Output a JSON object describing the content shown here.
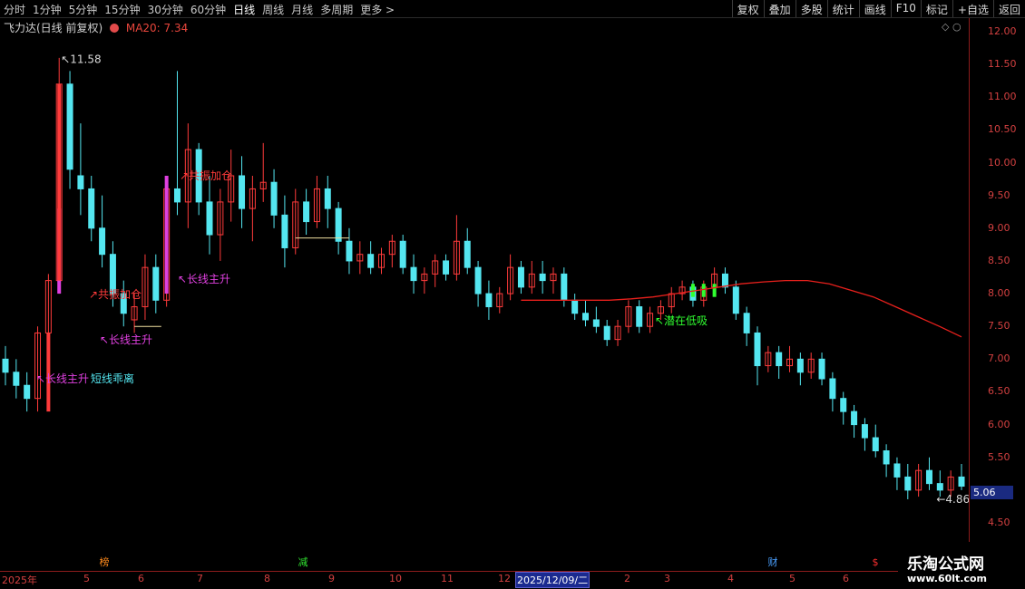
{
  "toolbar": {
    "periods": [
      "分时",
      "1分钟",
      "5分钟",
      "15分钟",
      "30分钟",
      "60分钟",
      "日线",
      "周线",
      "月线",
      "多周期",
      "更多 >"
    ],
    "active_period": "日线",
    "tools": [
      "复权",
      "叠加",
      "多股",
      "统计",
      "画线",
      "F10",
      "标记",
      "+自选",
      "返回"
    ]
  },
  "stock": {
    "name": "飞力达(日线 前复权)",
    "ma_label": "MA20: 7.34"
  },
  "colors": {
    "up": "#ff3b3b",
    "down": "#54e6f0",
    "ma20": "#e8201c",
    "axis": "#8c1c1c",
    "signal_magenta": "#e040e0",
    "signal_green": "#30ff30"
  },
  "yaxis": {
    "ticks": [
      "12.00",
      "11.50",
      "11.00",
      "10.50",
      "10.00",
      "9.50",
      "9.00",
      "8.50",
      "8.00",
      "7.50",
      "7.00",
      "6.50",
      "6.00",
      "5.50",
      "5.00",
      "4.50"
    ],
    "current_price": "5.06"
  },
  "annotations": {
    "high": "11.58",
    "low": "4.86",
    "a1": "长线主升",
    "a2": "短线乖离",
    "a3": "长线主升",
    "a4": "共振加仓",
    "a5": "长线主升",
    "a6": "共振加仓",
    "a7": "潜在低吸"
  },
  "events": [
    {
      "label": "榜",
      "color": "#ff8a1c"
    },
    {
      "label": "减",
      "color": "#30e030"
    },
    {
      "label": "财",
      "color": "#4aa0ff"
    },
    {
      "label": "$",
      "color": "#ff3030"
    }
  ],
  "xaxis": {
    "labels": [
      "2025年",
      "5",
      "6",
      "7",
      "8",
      "9",
      "10",
      "11",
      "12",
      "2025/12/09/二",
      "2",
      "3",
      "4",
      "5",
      "6"
    ]
  },
  "brand": {
    "name": "乐淘公式网",
    "url": "www.60lt.com"
  },
  "chart_data": {
    "type": "candlestick",
    "title": "飞力达(日线 前复权)",
    "ylim": [
      4.5,
      12.0
    ],
    "high": 11.58,
    "low": 4.86,
    "last_close": 5.06,
    "ma20_last": 7.34,
    "candles": [
      [
        7.0,
        7.2,
        6.6,
        6.8
      ],
      [
        6.8,
        7.0,
        6.4,
        6.6
      ],
      [
        6.6,
        6.8,
        6.2,
        6.4
      ],
      [
        6.4,
        7.5,
        6.2,
        7.4
      ],
      [
        7.4,
        8.3,
        7.2,
        8.2
      ],
      [
        8.2,
        11.6,
        8.0,
        11.2
      ],
      [
        11.2,
        11.4,
        9.6,
        9.9
      ],
      [
        9.8,
        10.6,
        9.2,
        9.6
      ],
      [
        9.6,
        9.8,
        8.8,
        9.0
      ],
      [
        9.0,
        9.5,
        8.4,
        8.6
      ],
      [
        8.6,
        8.8,
        7.8,
        8.0
      ],
      [
        8.0,
        8.2,
        7.5,
        7.7
      ],
      [
        7.6,
        8.0,
        7.4,
        7.8
      ],
      [
        7.8,
        8.6,
        7.6,
        8.4
      ],
      [
        8.4,
        8.6,
        7.7,
        7.9
      ],
      [
        7.9,
        9.8,
        7.8,
        9.6
      ],
      [
        9.6,
        11.4,
        9.2,
        9.4
      ],
      [
        9.4,
        10.6,
        9.0,
        10.2
      ],
      [
        10.2,
        10.3,
        9.2,
        9.4
      ],
      [
        9.4,
        9.8,
        8.6,
        8.9
      ],
      [
        8.9,
        9.6,
        8.5,
        9.4
      ],
      [
        9.4,
        10.2,
        9.1,
        9.8
      ],
      [
        9.8,
        10.1,
        9.0,
        9.3
      ],
      [
        9.3,
        9.8,
        8.8,
        9.6
      ],
      [
        9.6,
        10.3,
        9.4,
        9.7
      ],
      [
        9.7,
        9.9,
        9.0,
        9.2
      ],
      [
        9.2,
        9.5,
        8.4,
        8.7
      ],
      [
        8.7,
        9.6,
        8.6,
        9.4
      ],
      [
        9.4,
        9.6,
        8.9,
        9.1
      ],
      [
        9.1,
        9.8,
        9.0,
        9.6
      ],
      [
        9.6,
        9.8,
        9.0,
        9.3
      ],
      [
        9.3,
        9.4,
        8.6,
        8.8
      ],
      [
        8.8,
        9.0,
        8.3,
        8.5
      ],
      [
        8.5,
        8.8,
        8.3,
        8.6
      ],
      [
        8.6,
        8.8,
        8.3,
        8.4
      ],
      [
        8.4,
        8.7,
        8.3,
        8.6
      ],
      [
        8.6,
        8.9,
        8.4,
        8.8
      ],
      [
        8.8,
        8.9,
        8.3,
        8.4
      ],
      [
        8.4,
        8.6,
        8.0,
        8.2
      ],
      [
        8.2,
        8.4,
        8.0,
        8.3
      ],
      [
        8.3,
        8.6,
        8.1,
        8.5
      ],
      [
        8.5,
        8.6,
        8.2,
        8.3
      ],
      [
        8.3,
        9.2,
        8.2,
        8.8
      ],
      [
        8.8,
        9.0,
        8.3,
        8.4
      ],
      [
        8.4,
        8.5,
        7.8,
        8.0
      ],
      [
        8.0,
        8.2,
        7.6,
        7.8
      ],
      [
        7.8,
        8.1,
        7.7,
        8.0
      ],
      [
        8.0,
        8.6,
        7.9,
        8.4
      ],
      [
        8.4,
        8.5,
        8.0,
        8.1
      ],
      [
        8.1,
        8.5,
        8.0,
        8.3
      ],
      [
        8.3,
        8.5,
        8.0,
        8.2
      ],
      [
        8.2,
        8.4,
        8.0,
        8.3
      ],
      [
        8.3,
        8.4,
        7.8,
        7.9
      ],
      [
        7.9,
        8.0,
        7.6,
        7.7
      ],
      [
        7.7,
        7.9,
        7.5,
        7.6
      ],
      [
        7.6,
        7.8,
        7.4,
        7.5
      ],
      [
        7.5,
        7.6,
        7.2,
        7.3
      ],
      [
        7.3,
        7.6,
        7.2,
        7.5
      ],
      [
        7.5,
        7.9,
        7.4,
        7.8
      ],
      [
        7.8,
        7.9,
        7.4,
        7.5
      ],
      [
        7.5,
        7.8,
        7.4,
        7.7
      ],
      [
        7.7,
        7.9,
        7.6,
        7.8
      ],
      [
        7.8,
        8.1,
        7.7,
        8.0
      ],
      [
        8.0,
        8.2,
        7.9,
        8.1
      ],
      [
        8.1,
        8.2,
        7.8,
        7.9
      ],
      [
        7.9,
        8.2,
        7.8,
        8.1
      ],
      [
        8.1,
        8.4,
        8.0,
        8.3
      ],
      [
        8.3,
        8.4,
        8.0,
        8.1
      ],
      [
        8.1,
        8.2,
        7.6,
        7.7
      ],
      [
        7.7,
        7.8,
        7.2,
        7.4
      ],
      [
        7.4,
        7.5,
        6.6,
        6.9
      ],
      [
        6.9,
        7.2,
        6.8,
        7.1
      ],
      [
        7.1,
        7.2,
        6.7,
        6.9
      ],
      [
        6.9,
        7.2,
        6.8,
        7.0
      ],
      [
        7.0,
        7.1,
        6.6,
        6.8
      ],
      [
        6.8,
        7.1,
        6.7,
        7.0
      ],
      [
        7.0,
        7.1,
        6.6,
        6.7
      ],
      [
        6.7,
        6.8,
        6.2,
        6.4
      ],
      [
        6.4,
        6.5,
        6.0,
        6.2
      ],
      [
        6.2,
        6.3,
        5.8,
        6.0
      ],
      [
        6.0,
        6.1,
        5.6,
        5.8
      ],
      [
        5.8,
        6.0,
        5.5,
        5.6
      ],
      [
        5.6,
        5.7,
        5.2,
        5.4
      ],
      [
        5.4,
        5.5,
        5.0,
        5.2
      ],
      [
        5.2,
        5.4,
        4.86,
        5.0
      ],
      [
        5.0,
        5.4,
        4.9,
        5.3
      ],
      [
        5.3,
        5.5,
        5.0,
        5.1
      ],
      [
        5.1,
        5.3,
        4.9,
        5.0
      ],
      [
        5.0,
        5.3,
        4.9,
        5.2
      ],
      [
        5.2,
        5.4,
        5.0,
        5.06
      ]
    ],
    "ma20": [
      7.9,
      7.9,
      7.9,
      7.9,
      7.9,
      7.92,
      7.95,
      8.0,
      8.05,
      8.1,
      8.15,
      8.18,
      8.2,
      8.2,
      8.15,
      8.05,
      7.95,
      7.8,
      7.65,
      7.5,
      7.34
    ]
  }
}
